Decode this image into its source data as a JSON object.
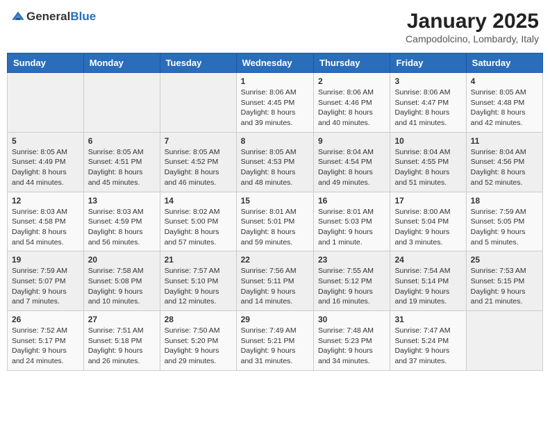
{
  "header": {
    "logo": {
      "general": "General",
      "blue": "Blue"
    },
    "title": "January 2025",
    "location": "Campodolcino, Lombardy, Italy"
  },
  "weekdays": [
    "Sunday",
    "Monday",
    "Tuesday",
    "Wednesday",
    "Thursday",
    "Friday",
    "Saturday"
  ],
  "weeks": [
    [
      {
        "day": "",
        "info": ""
      },
      {
        "day": "",
        "info": ""
      },
      {
        "day": "",
        "info": ""
      },
      {
        "day": "1",
        "info": "Sunrise: 8:06 AM\nSunset: 4:45 PM\nDaylight: 8 hours\nand 39 minutes."
      },
      {
        "day": "2",
        "info": "Sunrise: 8:06 AM\nSunset: 4:46 PM\nDaylight: 8 hours\nand 40 minutes."
      },
      {
        "day": "3",
        "info": "Sunrise: 8:06 AM\nSunset: 4:47 PM\nDaylight: 8 hours\nand 41 minutes."
      },
      {
        "day": "4",
        "info": "Sunrise: 8:05 AM\nSunset: 4:48 PM\nDaylight: 8 hours\nand 42 minutes."
      }
    ],
    [
      {
        "day": "5",
        "info": "Sunrise: 8:05 AM\nSunset: 4:49 PM\nDaylight: 8 hours\nand 44 minutes."
      },
      {
        "day": "6",
        "info": "Sunrise: 8:05 AM\nSunset: 4:51 PM\nDaylight: 8 hours\nand 45 minutes."
      },
      {
        "day": "7",
        "info": "Sunrise: 8:05 AM\nSunset: 4:52 PM\nDaylight: 8 hours\nand 46 minutes."
      },
      {
        "day": "8",
        "info": "Sunrise: 8:05 AM\nSunset: 4:53 PM\nDaylight: 8 hours\nand 48 minutes."
      },
      {
        "day": "9",
        "info": "Sunrise: 8:04 AM\nSunset: 4:54 PM\nDaylight: 8 hours\nand 49 minutes."
      },
      {
        "day": "10",
        "info": "Sunrise: 8:04 AM\nSunset: 4:55 PM\nDaylight: 8 hours\nand 51 minutes."
      },
      {
        "day": "11",
        "info": "Sunrise: 8:04 AM\nSunset: 4:56 PM\nDaylight: 8 hours\nand 52 minutes."
      }
    ],
    [
      {
        "day": "12",
        "info": "Sunrise: 8:03 AM\nSunset: 4:58 PM\nDaylight: 8 hours\nand 54 minutes."
      },
      {
        "day": "13",
        "info": "Sunrise: 8:03 AM\nSunset: 4:59 PM\nDaylight: 8 hours\nand 56 minutes."
      },
      {
        "day": "14",
        "info": "Sunrise: 8:02 AM\nSunset: 5:00 PM\nDaylight: 8 hours\nand 57 minutes."
      },
      {
        "day": "15",
        "info": "Sunrise: 8:01 AM\nSunset: 5:01 PM\nDaylight: 8 hours\nand 59 minutes."
      },
      {
        "day": "16",
        "info": "Sunrise: 8:01 AM\nSunset: 5:03 PM\nDaylight: 9 hours\nand 1 minute."
      },
      {
        "day": "17",
        "info": "Sunrise: 8:00 AM\nSunset: 5:04 PM\nDaylight: 9 hours\nand 3 minutes."
      },
      {
        "day": "18",
        "info": "Sunrise: 7:59 AM\nSunset: 5:05 PM\nDaylight: 9 hours\nand 5 minutes."
      }
    ],
    [
      {
        "day": "19",
        "info": "Sunrise: 7:59 AM\nSunset: 5:07 PM\nDaylight: 9 hours\nand 7 minutes."
      },
      {
        "day": "20",
        "info": "Sunrise: 7:58 AM\nSunset: 5:08 PM\nDaylight: 9 hours\nand 10 minutes."
      },
      {
        "day": "21",
        "info": "Sunrise: 7:57 AM\nSunset: 5:10 PM\nDaylight: 9 hours\nand 12 minutes."
      },
      {
        "day": "22",
        "info": "Sunrise: 7:56 AM\nSunset: 5:11 PM\nDaylight: 9 hours\nand 14 minutes."
      },
      {
        "day": "23",
        "info": "Sunrise: 7:55 AM\nSunset: 5:12 PM\nDaylight: 9 hours\nand 16 minutes."
      },
      {
        "day": "24",
        "info": "Sunrise: 7:54 AM\nSunset: 5:14 PM\nDaylight: 9 hours\nand 19 minutes."
      },
      {
        "day": "25",
        "info": "Sunrise: 7:53 AM\nSunset: 5:15 PM\nDaylight: 9 hours\nand 21 minutes."
      }
    ],
    [
      {
        "day": "26",
        "info": "Sunrise: 7:52 AM\nSunset: 5:17 PM\nDaylight: 9 hours\nand 24 minutes."
      },
      {
        "day": "27",
        "info": "Sunrise: 7:51 AM\nSunset: 5:18 PM\nDaylight: 9 hours\nand 26 minutes."
      },
      {
        "day": "28",
        "info": "Sunrise: 7:50 AM\nSunset: 5:20 PM\nDaylight: 9 hours\nand 29 minutes."
      },
      {
        "day": "29",
        "info": "Sunrise: 7:49 AM\nSunset: 5:21 PM\nDaylight: 9 hours\nand 31 minutes."
      },
      {
        "day": "30",
        "info": "Sunrise: 7:48 AM\nSunset: 5:23 PM\nDaylight: 9 hours\nand 34 minutes."
      },
      {
        "day": "31",
        "info": "Sunrise: 7:47 AM\nSunset: 5:24 PM\nDaylight: 9 hours\nand 37 minutes."
      },
      {
        "day": "",
        "info": ""
      }
    ]
  ]
}
